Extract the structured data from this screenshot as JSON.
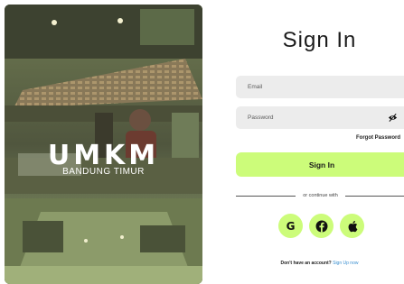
{
  "hero": {
    "brand_title": "UMKM",
    "brand_subtitle": "BANDUNG TIMUR"
  },
  "form": {
    "title": "Sign In",
    "email": {
      "placeholder": "Email",
      "value": ""
    },
    "password": {
      "placeholder": "Password",
      "value": ""
    },
    "forgot_password": "Forgot Password",
    "signin_button": "Sign In",
    "divider_text": "or continue with",
    "social": [
      {
        "label": "G",
        "icon": "google-icon"
      },
      {
        "label": "f",
        "icon": "facebook-icon"
      },
      {
        "label": "",
        "icon": "apple-icon"
      }
    ],
    "signup_prompt": "Don't have an account?",
    "signup_link": "Sign Up now"
  },
  "colors": {
    "accent": "#ccfc7a",
    "field_bg": "#ececec",
    "link": "#3a8fd0"
  }
}
